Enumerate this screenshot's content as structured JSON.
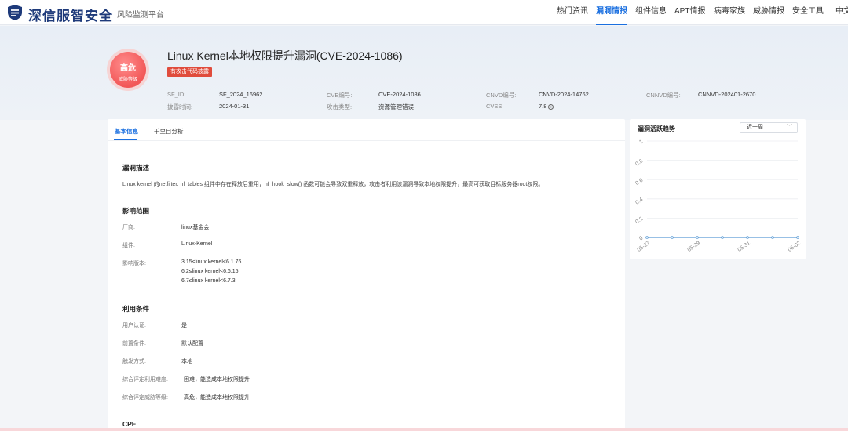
{
  "header": {
    "brand": "深信服智安全",
    "platform": "风险监测平台",
    "nav": [
      {
        "label": "热门资讯",
        "active": false
      },
      {
        "label": "漏洞情报",
        "active": true
      },
      {
        "label": "组件信息",
        "active": false
      },
      {
        "label": "APT情报",
        "active": false
      },
      {
        "label": "病毒家族",
        "active": false
      },
      {
        "label": "威胁情报",
        "active": false
      },
      {
        "label": "安全工具",
        "active": false
      },
      {
        "label": "中文",
        "active": false
      }
    ]
  },
  "vuln": {
    "badge_level": "高危",
    "badge_sub": "威胁等级",
    "title": "Linux Kernel本地权限提升漏洞(CVE-2024-1086)",
    "tag": "有攻击代码披露",
    "meta": {
      "sf_id_label": "SF_ID:",
      "sf_id": "SF_2024_16962",
      "cve_label": "CVE编号:",
      "cve": "CVE-2024-1086",
      "cnvd_label": "CNVD编号:",
      "cnvd": "CNVD-2024-14762",
      "cnnvd_label": "CNNVD编号:",
      "cnnvd": "CNNVD-202401-2670",
      "disclosed_label": "披露时间:",
      "disclosed": "2024-01-31",
      "attack_type_label": "攻击类型:",
      "attack_type": "资源管理错误",
      "cvss_label": "CVSS:",
      "cvss": "7.8"
    }
  },
  "tabs": {
    "basic": "基本信息",
    "analysis": "千里目分析"
  },
  "basic": {
    "desc_title": "漏洞描述",
    "desc": "Linux kernel 的netfilter: nf_tables 组件中存在释放后重用，nf_hook_slow() 函数可能会导致双重释放，攻击者利用该漏洞导致本地权限提升，最高可获取目标服务器root权限。",
    "scope_title": "影响范围",
    "vendor_label": "厂商:",
    "vendor": "linux基金会",
    "component_label": "组件:",
    "component": "Linux-Kernel",
    "versions_label": "影响版本:",
    "versions": [
      "3.15≤linux kernel<6.1.76",
      "6.2≤linux kernel<6.6.15",
      "6.7≤linux kernel<6.7.3"
    ],
    "cond_title": "利用条件",
    "auth_label": "用户认证:",
    "auth": "是",
    "precond_label": "前置条件:",
    "precond": "默认配置",
    "trigger_label": "触发方式:",
    "trigger": "本地",
    "difficulty_label": "综合评定利用难度:",
    "difficulty": "困难，能造成本地权限提升",
    "threat_label": "综合评定威胁等级:",
    "threat": "高危，能造成本地权限提升",
    "cpe_title": "CPE"
  },
  "trend": {
    "title": "漏洞活跃趋势",
    "range": "近一周"
  },
  "chart_data": {
    "type": "line",
    "x": [
      "05-27",
      "05-28",
      "05-29",
      "05-30",
      "05-31",
      "06-01",
      "06-02"
    ],
    "tick_labels": [
      "05-27",
      "05-29",
      "05-31",
      "06-02"
    ],
    "series": [
      {
        "values": [
          0,
          0,
          0,
          0,
          0,
          0,
          0
        ]
      }
    ],
    "y_ticks": [
      "0",
      "0.2",
      "0.4",
      "0.6",
      "0.8",
      "1"
    ],
    "ylim": [
      0,
      1
    ],
    "grid": true,
    "color": "#5b9bd5"
  }
}
